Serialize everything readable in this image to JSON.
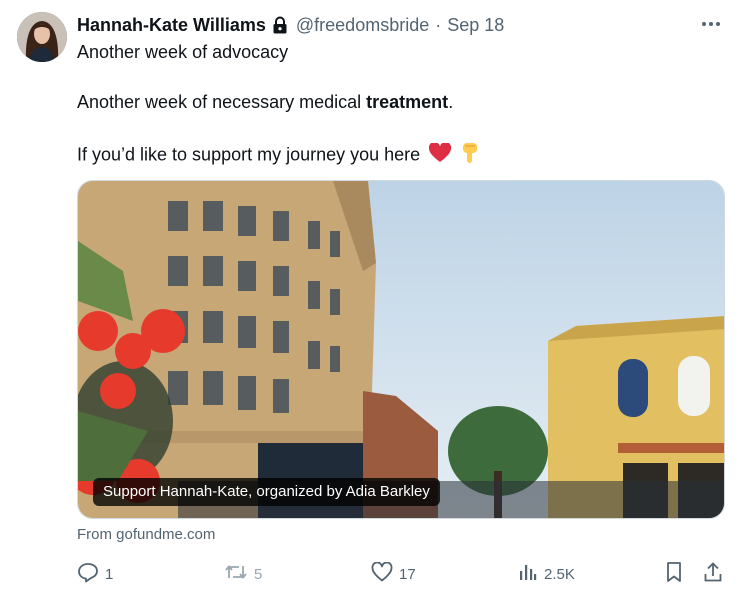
{
  "tweet": {
    "display_name": "Hannah-Kate Williams",
    "handle": "@freedomsbride",
    "separator": "·",
    "date": "Sep 18",
    "line1": "Another week of advocacy",
    "line2_prefix": "Another week of necessary medical ",
    "line2_bold": "treatment",
    "line2_suffix": ".",
    "line3": "If you’d like to support my journey you here",
    "emojis": [
      "red-heart",
      "pointing-down-hand"
    ]
  },
  "card": {
    "caption": "Support Hannah-Kate, organized by Adia Barkley",
    "source": "From gofundme.com"
  },
  "actions": {
    "replies": "1",
    "retweets": "5",
    "likes": "17",
    "views": "2.5K"
  },
  "icons": {
    "more": "more-icon",
    "lock": "lock-icon",
    "reply": "reply-icon",
    "retweet": "retweet-icon",
    "like": "like-icon",
    "views": "views-icon",
    "bookmark": "bookmark-icon",
    "share": "share-icon"
  },
  "colors": {
    "text": "#0f1419",
    "muted": "#536471",
    "heart": "#e0245e"
  }
}
